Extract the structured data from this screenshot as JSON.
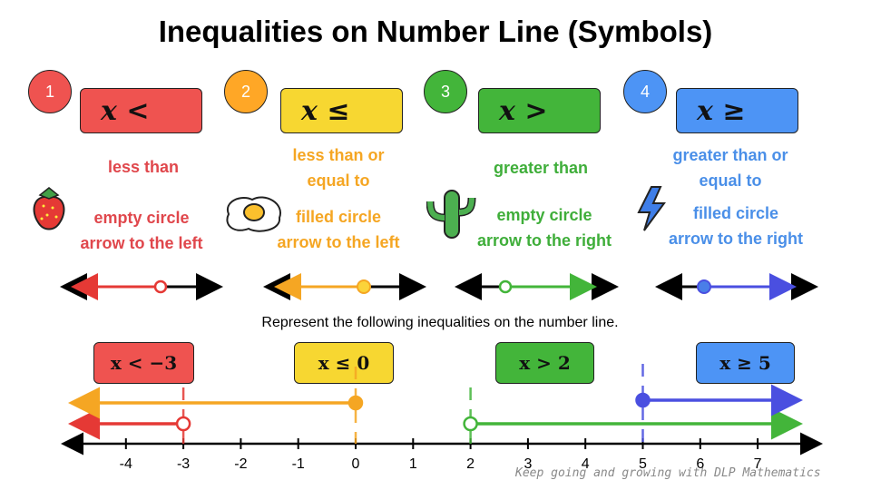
{
  "title": "Inequalities on Number Line (Symbols)",
  "cards": [
    {
      "number": "1",
      "symbol": "x <",
      "label": "less than",
      "rule1": "empty circle",
      "rule2": "arrow to the left",
      "color": "#ef5350",
      "text_color": "#e0474c",
      "icon": "strawberry-icon"
    },
    {
      "number": "2",
      "symbol": "x ≤",
      "label1": "less than or",
      "label2": "equal to",
      "rule1": "filled circle",
      "rule2": "arrow to the left",
      "color": "#f7d731",
      "num_color": "#ffa726",
      "text_color": "#f5a623",
      "icon": "fried-egg-icon"
    },
    {
      "number": "3",
      "symbol": "x >",
      "label": "greater than",
      "rule1": "empty circle",
      "rule2": "arrow to the right",
      "color": "#43b53a",
      "text_color": "#3fae3a",
      "icon": "cactus-icon"
    },
    {
      "number": "4",
      "symbol": "x ≥",
      "label1": "greater than or",
      "label2": "equal to",
      "rule1": "filled circle",
      "rule2": "arrow to the right",
      "color": "#4d94f5",
      "text_color": "#4a8fe8",
      "icon": "lightning-icon"
    }
  ],
  "instruction": "Represent the following inequalities on the number line.",
  "exercises": [
    {
      "text": "x < −3",
      "boundary": -3,
      "closed": false,
      "direction": "left",
      "color": "#e53935"
    },
    {
      "text": "x ≤ 0",
      "boundary": 0,
      "closed": true,
      "direction": "left",
      "color": "#f5a623"
    },
    {
      "text": "x > 2",
      "boundary": 2,
      "closed": false,
      "direction": "right",
      "color": "#43b53a"
    },
    {
      "text": "x ≥ 5",
      "boundary": 5,
      "closed": true,
      "direction": "right",
      "color": "#4a4fe0"
    }
  ],
  "ticks": [
    "-4",
    "-3",
    "-2",
    "-1",
    "0",
    "1",
    "2",
    "3",
    "4",
    "5",
    "6",
    "7"
  ],
  "signature": "Keep going and growing with DLP Mathematics"
}
